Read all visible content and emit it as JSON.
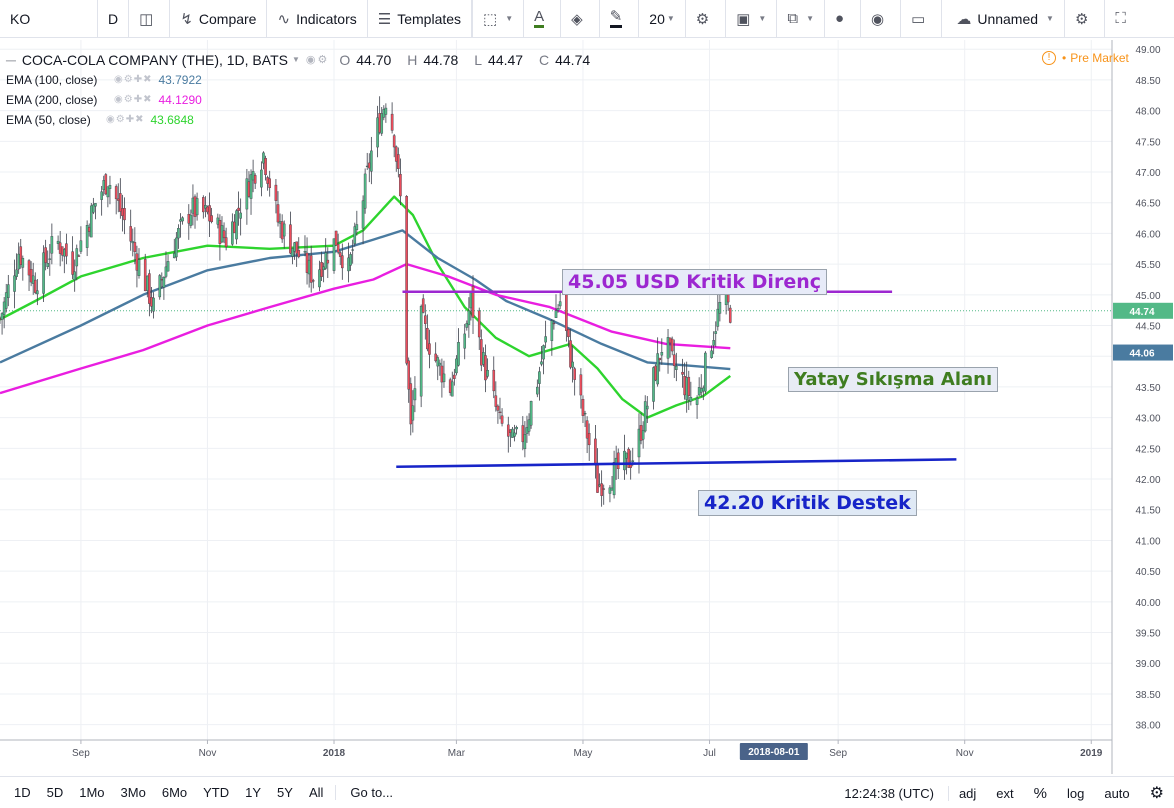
{
  "toolbar": {
    "symbol": "KO",
    "interval": "D",
    "compare": "Compare",
    "indicators": "Indicators",
    "templates": "Templates",
    "font_size": "20",
    "layout_name": "Unnamed"
  },
  "legend": {
    "title": "COCA-COLA COMPANY (THE), 1D, BATS",
    "ohlc": [
      {
        "label": "O",
        "value": "44.70"
      },
      {
        "label": "H",
        "value": "44.78"
      },
      {
        "label": "L",
        "value": "44.47"
      },
      {
        "label": "C",
        "value": "44.74"
      }
    ],
    "indicators": [
      {
        "name": "EMA (100, close)",
        "value": "43.7922",
        "color": "#4a7ba0"
      },
      {
        "name": "EMA (200, close)",
        "value": "44.1290",
        "color": "#e91ee0"
      },
      {
        "name": "EMA (50, close)",
        "value": "43.6848",
        "color": "#2ed42e"
      }
    ]
  },
  "status": {
    "pre_market": "Pre Market"
  },
  "annotations": {
    "resistance": "45.05 USD Kritik Direnç",
    "range": "Yatay Sıkışma Alanı",
    "support": "42.20 Kritik Destek"
  },
  "bottom": {
    "ranges": [
      "1D",
      "5D",
      "1Mo",
      "3Mo",
      "6Mo",
      "YTD",
      "1Y",
      "5Y",
      "All"
    ],
    "goto": "Go to...",
    "time": "12:24:38 (UTC)",
    "options": [
      "adj",
      "ext",
      "%",
      "log",
      "auto"
    ]
  },
  "colors": {
    "up": "#53b987",
    "down": "#eb4d5c",
    "ema50": "#2ed42e",
    "ema100": "#4a7ba0",
    "ema200": "#e91ee0",
    "resistance_line": "#9c27d0",
    "support_line": "#1724c8"
  },
  "chart_data": {
    "type": "candlestick",
    "title": "COCA-COLA COMPANY (THE), 1D, BATS",
    "ylim": [
      37.75,
      49.15
    ],
    "y_ticks": [
      38.0,
      38.5,
      39.0,
      39.5,
      40.0,
      40.5,
      41.0,
      41.5,
      42.0,
      42.5,
      43.0,
      43.5,
      44.0,
      44.5,
      45.0,
      45.5,
      46.0,
      46.5,
      47.0,
      47.5,
      48.0,
      48.5,
      49.0
    ],
    "x_range": [
      "2017-07-24",
      "2019-01-11"
    ],
    "x_ticks": [
      {
        "label": "Sep",
        "date": "2017-09-01"
      },
      {
        "label": "Nov",
        "date": "2017-11-01"
      },
      {
        "label": "2018",
        "date": "2018-01-01"
      },
      {
        "label": "Mar",
        "date": "2018-03-01"
      },
      {
        "label": "May",
        "date": "2018-05-01"
      },
      {
        "label": "Jul",
        "date": "2018-07-01"
      },
      {
        "label": "2018-08-01",
        "date": "2018-08-01"
      },
      {
        "label": "Sep",
        "date": "2018-09-01"
      },
      {
        "label": "Nov",
        "date": "2018-11-01"
      },
      {
        "label": "2019",
        "date": "2019-01-01"
      }
    ],
    "x_crosshair_label": "2018-08-01",
    "last_price": 44.74,
    "price_labels": [
      {
        "value": 44.74,
        "text": "44.74",
        "color": "#53b987"
      },
      {
        "value": 44.06,
        "text": "44.06",
        "color": "#4a7ba0"
      }
    ],
    "close_anchors": [
      [
        "2017-07-24",
        44.6
      ],
      [
        "2017-08-02",
        45.7
      ],
      [
        "2017-08-10",
        45.2
      ],
      [
        "2017-08-20",
        45.9
      ],
      [
        "2017-08-28",
        45.5
      ],
      [
        "2017-09-08",
        46.5
      ],
      [
        "2017-09-14",
        46.9
      ],
      [
        "2017-09-22",
        46.2
      ],
      [
        "2017-10-01",
        45.3
      ],
      [
        "2017-10-06",
        44.8
      ],
      [
        "2017-10-14",
        45.7
      ],
      [
        "2017-10-24",
        46.4
      ],
      [
        "2017-11-01",
        46.3
      ],
      [
        "2017-11-10",
        45.9
      ],
      [
        "2017-11-22",
        46.9
      ],
      [
        "2017-11-28",
        47.3
      ],
      [
        "2017-12-05",
        46.2
      ],
      [
        "2017-12-12",
        45.8
      ],
      [
        "2017-12-22",
        45.3
      ],
      [
        "2018-01-02",
        45.9
      ],
      [
        "2018-01-08",
        45.4
      ],
      [
        "2018-01-14",
        46.4
      ],
      [
        "2018-01-20",
        47.5
      ],
      [
        "2018-01-26",
        48.2
      ],
      [
        "2018-01-30",
        47.6
      ],
      [
        "2018-02-03",
        46.2
      ],
      [
        "2018-02-05",
        44.0
      ],
      [
        "2018-02-07",
        42.8
      ],
      [
        "2018-02-12",
        44.6
      ],
      [
        "2018-02-18",
        44.0
      ],
      [
        "2018-02-26",
        43.5
      ],
      [
        "2018-03-05",
        44.4
      ],
      [
        "2018-03-08",
        44.9
      ],
      [
        "2018-03-14",
        43.9
      ],
      [
        "2018-03-22",
        42.9
      ],
      [
        "2018-03-28",
        42.6
      ],
      [
        "2018-04-02",
        42.7
      ],
      [
        "2018-04-09",
        43.6
      ],
      [
        "2018-04-14",
        44.4
      ],
      [
        "2018-04-20",
        44.9
      ],
      [
        "2018-04-26",
        43.8
      ],
      [
        "2018-05-02",
        42.9
      ],
      [
        "2018-05-08",
        41.9
      ],
      [
        "2018-05-12",
        42.0
      ],
      [
        "2018-05-20",
        42.2
      ],
      [
        "2018-05-26",
        42.4
      ],
      [
        "2018-06-03",
        43.5
      ],
      [
        "2018-06-09",
        44.3
      ],
      [
        "2018-06-13",
        43.9
      ],
      [
        "2018-06-18",
        43.6
      ],
      [
        "2018-06-24",
        43.2
      ],
      [
        "2018-06-28",
        43.7
      ],
      [
        "2018-07-03",
        44.4
      ],
      [
        "2018-07-07",
        44.95
      ],
      [
        "2018-07-11",
        44.74
      ]
    ],
    "ema_lines": [
      {
        "name": "EMA (50, close)",
        "color": "#2ed42e",
        "value": 43.6848,
        "points": [
          [
            "2017-07-24",
            44.6
          ],
          [
            "2017-08-10",
            44.9
          ],
          [
            "2017-09-01",
            45.3
          ],
          [
            "2017-10-01",
            45.6
          ],
          [
            "2017-11-01",
            45.8
          ],
          [
            "2017-12-01",
            45.75
          ],
          [
            "2018-01-01",
            45.8
          ],
          [
            "2018-01-15",
            46.05
          ],
          [
            "2018-01-30",
            46.6
          ],
          [
            "2018-02-08",
            46.3
          ],
          [
            "2018-02-20",
            45.5
          ],
          [
            "2018-03-05",
            44.8
          ],
          [
            "2018-03-20",
            44.3
          ],
          [
            "2018-04-05",
            44.0
          ],
          [
            "2018-04-25",
            44.2
          ],
          [
            "2018-05-08",
            43.8
          ],
          [
            "2018-05-20",
            43.3
          ],
          [
            "2018-06-01",
            43.0
          ],
          [
            "2018-06-15",
            43.2
          ],
          [
            "2018-06-28",
            43.35
          ],
          [
            "2018-07-11",
            43.68
          ]
        ]
      },
      {
        "name": "EMA (100, close)",
        "color": "#4a7ba0",
        "value": 43.7922,
        "points": [
          [
            "2017-07-24",
            43.9
          ],
          [
            "2017-09-01",
            44.5
          ],
          [
            "2017-10-01",
            45.0
          ],
          [
            "2017-11-01",
            45.4
          ],
          [
            "2017-12-01",
            45.6
          ],
          [
            "2018-01-01",
            45.7
          ],
          [
            "2018-01-20",
            45.9
          ],
          [
            "2018-02-03",
            46.05
          ],
          [
            "2018-02-20",
            45.6
          ],
          [
            "2018-03-10",
            45.25
          ],
          [
            "2018-03-25",
            44.9
          ],
          [
            "2018-04-15",
            44.6
          ],
          [
            "2018-05-10",
            44.2
          ],
          [
            "2018-06-01",
            43.9
          ],
          [
            "2018-06-20",
            43.85
          ],
          [
            "2018-07-11",
            43.79
          ]
        ]
      },
      {
        "name": "EMA (200, close)",
        "color": "#e91ee0",
        "value": 44.129,
        "points": [
          [
            "2017-07-24",
            43.4
          ],
          [
            "2017-09-01",
            43.8
          ],
          [
            "2017-10-01",
            44.1
          ],
          [
            "2017-11-01",
            44.5
          ],
          [
            "2017-12-01",
            44.8
          ],
          [
            "2018-01-01",
            45.1
          ],
          [
            "2018-01-20",
            45.25
          ],
          [
            "2018-02-05",
            45.5
          ],
          [
            "2018-02-25",
            45.3
          ],
          [
            "2018-03-20",
            45.0
          ],
          [
            "2018-04-15",
            44.8
          ],
          [
            "2018-05-15",
            44.4
          ],
          [
            "2018-06-10",
            44.2
          ],
          [
            "2018-07-11",
            44.13
          ]
        ]
      }
    ],
    "trend_lines": [
      {
        "name": "resistance",
        "color": "#9c27d0",
        "from": [
          "2018-02-03",
          45.05
        ],
        "to": [
          "2018-09-27",
          45.05
        ]
      },
      {
        "name": "support",
        "color": "#1724c8",
        "from": [
          "2018-01-31",
          42.2
        ],
        "to": [
          "2018-10-28",
          42.32
        ]
      }
    ]
  }
}
